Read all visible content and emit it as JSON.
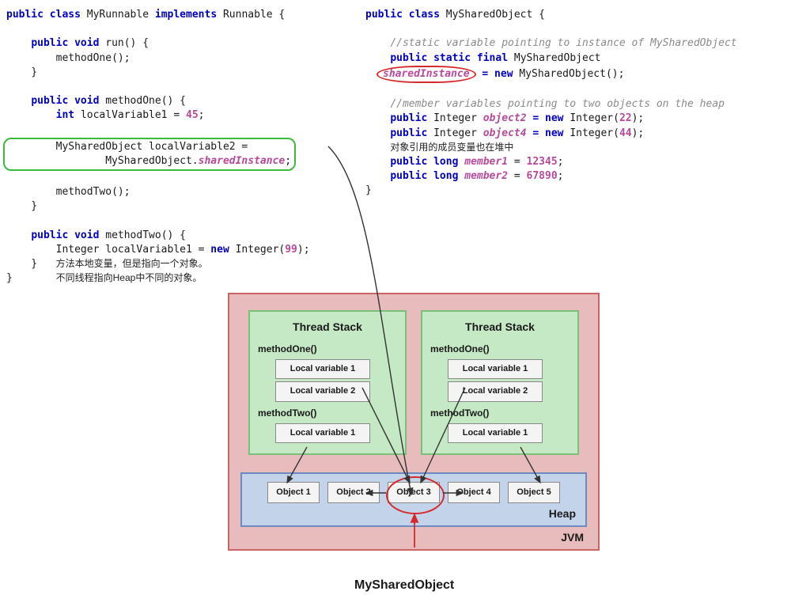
{
  "left_code": {
    "class_decl_1": "public",
    "class_decl_2": "class",
    "class_name": "MyRunnable",
    "class_decl_3": "implements",
    "impl_name": "Runnable",
    "run_sig_1": "public",
    "run_sig_2": "void",
    "run_name": "run() {",
    "run_body": "methodOne();",
    "m1_sig_1": "public",
    "m1_sig_2": "void",
    "m1_name": "methodOne() {",
    "m1_int": "int",
    "m1_lv1": "localVariable1 = ",
    "m1_lv1_val": "45",
    "m1_lv2_line1": "MySharedObject localVariable2 =",
    "m1_lv2_line2_a": "MySharedObject.",
    "m1_lv2_line2_b": "sharedInstance",
    "m1_call": "methodTwo();",
    "m2_sig_1": "public",
    "m2_sig_2": "void",
    "m2_name": "methodTwo() {",
    "m2_line_a": "Integer localVariable1 = ",
    "m2_new": "new",
    "m2_line_b": " Integer(",
    "m2_val": "99",
    "m2_line_c": ");",
    "anno1": "方法本地变量，但是指向一个对象。",
    "anno2": "不同线程指向Heap中不同的对象。"
  },
  "right_code": {
    "class_decl_1": "public",
    "class_decl_2": "class",
    "class_name": "MySharedObject {",
    "cmt1": "//static variable pointing to instance of MySharedObject",
    "sf_1": "public",
    "sf_2": "static",
    "sf_3": "final",
    "sf_type": "MySharedObject",
    "sf_name": "sharedInstance",
    "sf_new": "= new",
    "sf_ctor": " MySharedObject();",
    "cmt2": "//member variables pointing to two objects on the heap",
    "o2_a": "public",
    "o2_b": "Integer",
    "o2_name": "object2",
    "o2_new": " = new",
    "o2_c": " Integer(",
    "o2_v": "22",
    "o2_d": ");",
    "o4_a": "public",
    "o4_b": "Integer",
    "o4_name": "object4",
    "o4_new": " = new",
    "o4_c": " Integer(",
    "o4_v": "44",
    "o4_d": ");",
    "anno3": "对象引用的成员变量也在堆中",
    "m1_a": "public",
    "m1_b": "long",
    "m1_name": "member1",
    "m1_eq": " = ",
    "m1_v": "12345",
    "m2_a": "public",
    "m2_b": "long",
    "m2_name": "member2",
    "m2_eq": " = ",
    "m2_v": "67890"
  },
  "diagram": {
    "stack_title": "Thread Stack",
    "method_one": "methodOne()",
    "method_two": "methodTwo()",
    "lv1": "Local variable 1",
    "lv2": "Local variable 2",
    "obj1": "Object 1",
    "obj2": "Object 2",
    "obj3": "Object 3",
    "obj4": "Object 4",
    "obj5": "Object 5",
    "heap_label": "Heap",
    "jvm_label": "JVM",
    "shared_label": "MySharedObject"
  }
}
